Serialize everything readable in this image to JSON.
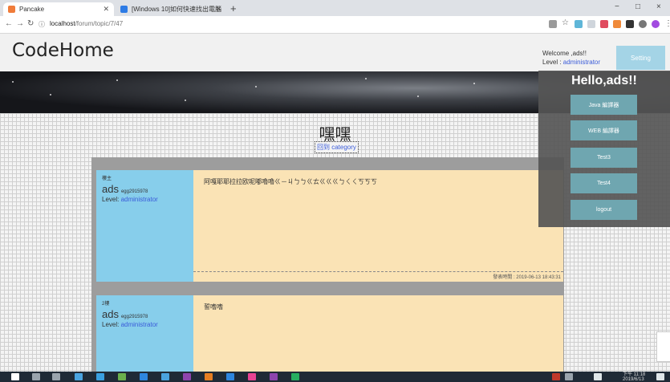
{
  "browser": {
    "tabs": [
      {
        "title": "Pancake",
        "favicon_color": "#f07c3a",
        "active": true
      },
      {
        "title": "[Windows 10]如何快速找出電腦",
        "favicon_color": "#2d7be5",
        "active": false
      }
    ],
    "url_host": "localhost",
    "url_path": "/forum/topic/7/47",
    "new_tab": "+",
    "window_controls": [
      "−",
      "□",
      "×"
    ]
  },
  "site": {
    "logo": "CodeHome",
    "welcome_line": "Welcome ,ads!!",
    "level_label": "Level : ",
    "level_value": "administrator",
    "setting_label": "Setting"
  },
  "topic": {
    "title": "嘿嘿",
    "back_link": "回到 category"
  },
  "posts": [
    {
      "floor": "樓主",
      "author": "ads",
      "author_id": "egg2915978",
      "level_label": "Level: ",
      "level_value": "administrator",
      "body": "阿嘎耶耶拉拉欧呢嘟嚕嚕ㄍ－ㄐㄅㄅㄍㄊㄍㄍㄍㄅㄑㄑㄎㄎㄎ",
      "timestamp": "發表時間 : 2019-06-13 18:43:31"
    },
    {
      "floor": "2樓",
      "author": "ads",
      "author_id": "egg2915978",
      "level_label": "Level: ",
      "level_value": "administrator",
      "body": "誓嗜嗜",
      "timestamp": ""
    }
  ],
  "dropdown": {
    "greeting": "Hello,ads!!",
    "items": [
      "Java 編譯器",
      "WEB 編譯器",
      "Test3",
      "Test4",
      "logout"
    ]
  },
  "taskbar": {
    "time": "下午 11:18",
    "date": "2019/6/13"
  },
  "colors": {
    "author_panel": "#87ceeb",
    "content_panel": "#fae3b5",
    "menu_button": "#6fa6b0",
    "level_link": "#3a5bd9"
  }
}
